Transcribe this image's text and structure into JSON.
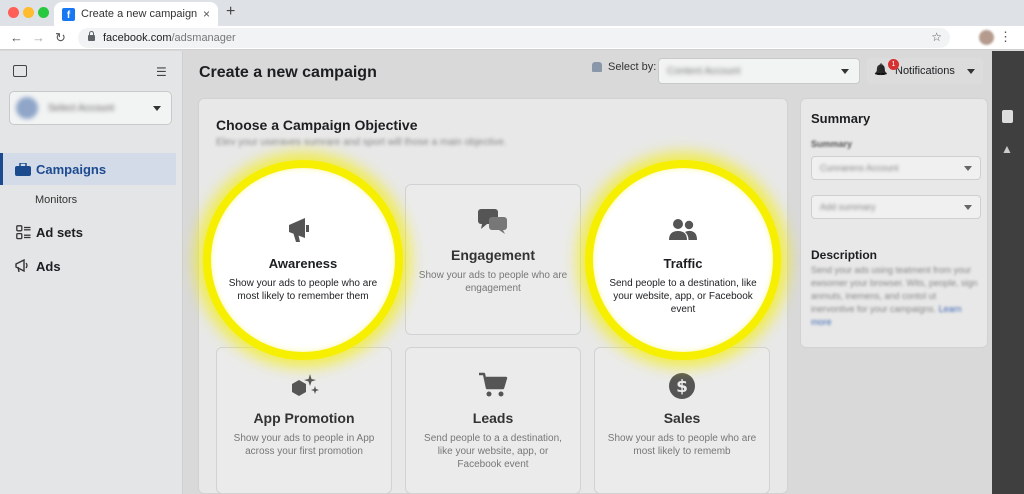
{
  "browser": {
    "tab_title": "Create a new campaign",
    "favicon_letter": "f",
    "tab_close": "×",
    "new_tab": "+",
    "url_domain": "facebook.com",
    "url_path": "/adsmanager",
    "icons": [
      "back-arrow-icon",
      "forward-arrow-icon",
      "reload-icon",
      "lock-icon",
      "star-icon",
      "kebab-menu-icon"
    ]
  },
  "sidebar": {
    "account_name": "Select Account",
    "items": [
      {
        "label": "Campaigns",
        "icon": "briefcase-icon",
        "active": true
      },
      {
        "label": "Monitors"
      },
      {
        "label": "Ad sets",
        "icon": "grid-icon"
      },
      {
        "label": "Ads",
        "icon": "megaphone-icon"
      }
    ]
  },
  "header": {
    "title": "Create a new campaign",
    "select_by_label": "Select by:",
    "select_value": "Content Account",
    "notifications_label": "Notifications",
    "notifications_count": "1"
  },
  "objective": {
    "title": "Choose a Campaign Objective",
    "subtitle": "Elev your useraves sumrare and sport will those a main objective.",
    "cards": [
      {
        "title": "Awareness",
        "desc": "Show your ads to people who are most likely to remember them",
        "icon": "megaphone-icon",
        "highlighted": true
      },
      {
        "title": "Engagement",
        "desc": "Show your ads to people who are engagement",
        "icon": "chat-bubbles-icon"
      },
      {
        "title": "Traffic",
        "desc": "Send people to a destination, like your website, app, or Facebook event",
        "icon": "people-icon",
        "highlighted": true
      },
      {
        "title": "App Promotion",
        "desc": "Show your ads to people in App across your first promotion",
        "icon": "cube-sparkle-icon"
      },
      {
        "title": "Leads",
        "desc": "Send people to a a destination, like your website, app, or Facebook event",
        "icon": "shopping-cart-icon"
      },
      {
        "title": "Sales",
        "desc": "Show your ads to people who are most likely to rememb",
        "icon": "dollar-coin-icon"
      }
    ]
  },
  "summary": {
    "title": "Summary",
    "label": "Summary",
    "account_value": "Cunnarens Account",
    "add_placeholder": "Add summary",
    "description_title": "Description",
    "description_body": "Send your ads using teatment from your ewsomer your browser. Wits, people, sign anmuts, inemens, and contol ut inervontive for your campaigns.",
    "learn_more": "Learn more"
  },
  "colors": {
    "highlight": "#f7ef00",
    "brand": "#1877f2",
    "active_nav": "#1b4a8f",
    "badge": "#d63030"
  }
}
